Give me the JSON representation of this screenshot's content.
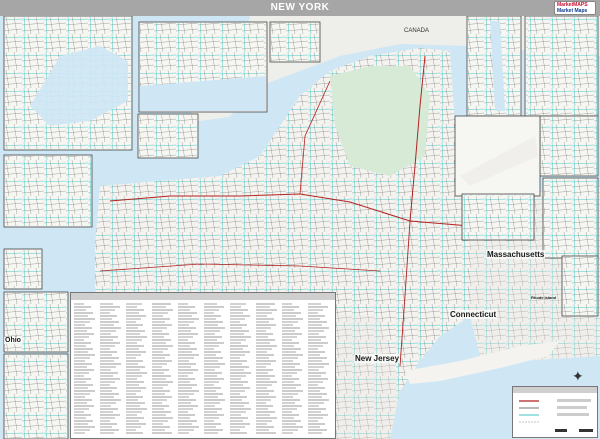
{
  "title": "NEW YORK",
  "logo": {
    "line1": "MarketMAPS",
    "line2": "Market Maps"
  },
  "labels": {
    "canada": "CANADA",
    "massachusetts": "Massachusetts",
    "connecticut": "Connecticut",
    "new_jersey": "New Jersey",
    "rhode_island": "Rhode Island",
    "ohio": "Ohio"
  },
  "colors": {
    "water": "#cfe7f5",
    "land": "#f4f3ef",
    "park": "#d6ead6",
    "highway": "#b22222",
    "road": "#2b2b2b",
    "county_line": "#00b3b3"
  },
  "icons": {
    "compass": "compass-rose-icon"
  }
}
